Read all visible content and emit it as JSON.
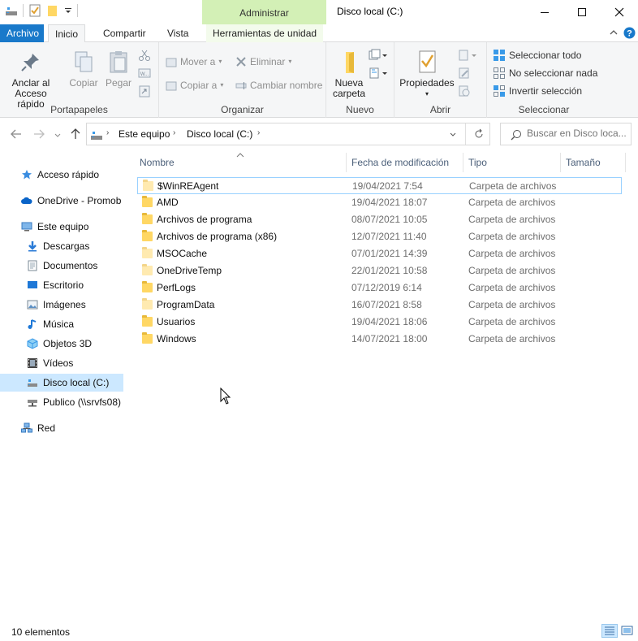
{
  "window": {
    "title": "Disco local (C:)",
    "context_band": "Administrar",
    "controls": [
      "minimize",
      "maximize",
      "close"
    ]
  },
  "ribbon_tabs": {
    "file": "Archivo",
    "home": "Inicio",
    "share": "Compartir",
    "view": "Vista",
    "drive_tools": "Herramientas de unidad"
  },
  "ribbon": {
    "portapapeles": {
      "label": "Portapapeles",
      "pin": "Anclar al\nAcceso rápido",
      "copy": "Copiar",
      "paste": "Pegar"
    },
    "organizar": {
      "label": "Organizar",
      "move_to": "Mover a",
      "copy_to": "Copiar a",
      "delete": "Eliminar",
      "rename": "Cambiar nombre"
    },
    "nuevo": {
      "label": "Nuevo",
      "new_folder": "Nueva\ncarpeta"
    },
    "abrir": {
      "label": "Abrir",
      "properties": "Propiedades"
    },
    "seleccionar": {
      "label": "Seleccionar",
      "select_all": "Seleccionar todo",
      "select_none": "No seleccionar nada",
      "invert": "Invertir selección"
    }
  },
  "address": {
    "crumbs": [
      "Este equipo",
      "Disco local (C:)"
    ],
    "search_placeholder": "Buscar en Disco loca..."
  },
  "nav": {
    "quick_access": "Acceso rápido",
    "onedrive": "OneDrive - Promob",
    "this_pc": "Este equipo",
    "downloads": "Descargas",
    "documents": "Documentos",
    "desktop": "Escritorio",
    "pictures": "Imágenes",
    "music": "Música",
    "objects3d": "Objetos 3D",
    "videos": "Vídeos",
    "local_disk": "Disco local (C:)",
    "publico": "Publico (\\\\srvfs08)",
    "network": "Red"
  },
  "columns": {
    "name": "Nombre",
    "date": "Fecha de modificación",
    "type": "Tipo",
    "size": "Tamaño"
  },
  "files": [
    {
      "name": "$WinREAgent",
      "date": "19/04/2021 7:54",
      "type": "Carpeta de archivos",
      "hidden": true
    },
    {
      "name": "AMD",
      "date": "19/04/2021 18:07",
      "type": "Carpeta de archivos",
      "hidden": false
    },
    {
      "name": "Archivos de programa",
      "date": "08/07/2021 10:05",
      "type": "Carpeta de archivos",
      "hidden": false
    },
    {
      "name": "Archivos de programa (x86)",
      "date": "12/07/2021 11:40",
      "type": "Carpeta de archivos",
      "hidden": false
    },
    {
      "name": "MSOCache",
      "date": "07/01/2021 14:39",
      "type": "Carpeta de archivos",
      "hidden": true
    },
    {
      "name": "OneDriveTemp",
      "date": "22/01/2021 10:58",
      "type": "Carpeta de archivos",
      "hidden": true
    },
    {
      "name": "PerfLogs",
      "date": "07/12/2019 6:14",
      "type": "Carpeta de archivos",
      "hidden": false
    },
    {
      "name": "ProgramData",
      "date": "16/07/2021 8:58",
      "type": "Carpeta de archivos",
      "hidden": true
    },
    {
      "name": "Usuarios",
      "date": "19/04/2021 18:06",
      "type": "Carpeta de archivos",
      "hidden": false
    },
    {
      "name": "Windows",
      "date": "14/07/2021 18:00",
      "type": "Carpeta de archivos",
      "hidden": false
    }
  ],
  "status": {
    "count": "10 elementos"
  },
  "colors": {
    "file_tab": "#1979ca",
    "context_band": "#d3f0b6",
    "selection": "#cce8ff",
    "folder": "#ffd764"
  }
}
